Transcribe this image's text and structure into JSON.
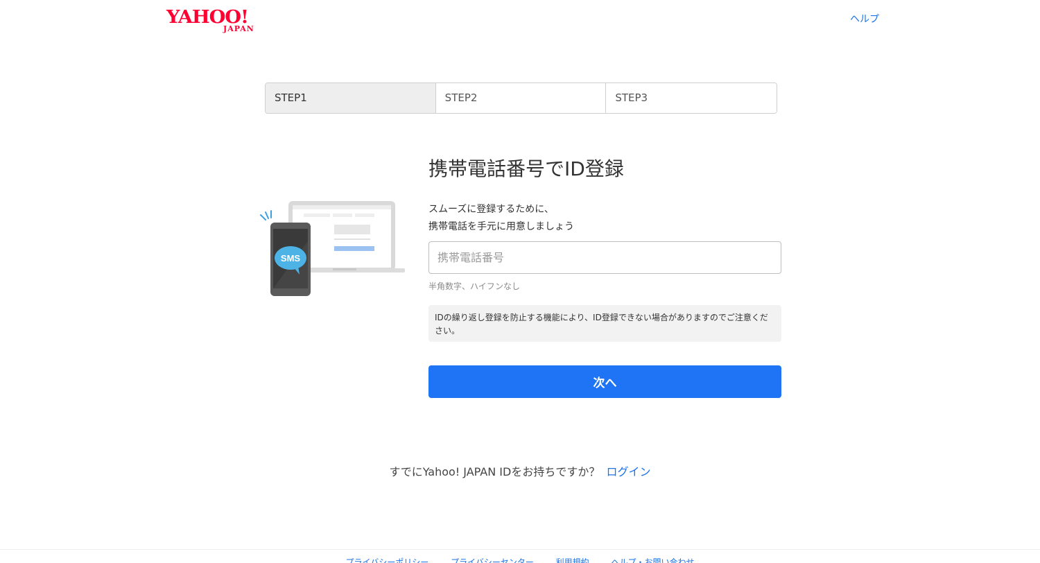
{
  "header": {
    "logo_main": "YAHOO!",
    "logo_sub": "JAPAN",
    "help_label": "ヘルプ"
  },
  "steps": [
    {
      "label": "STEP1",
      "active": true
    },
    {
      "label": "STEP2",
      "active": false
    },
    {
      "label": "STEP3",
      "active": false
    }
  ],
  "illustration": {
    "badge_text": "SMS"
  },
  "main": {
    "title": "携帯電話番号でID登録",
    "lead_line1": "スムーズに登録するために、",
    "lead_line2": "携帯電話を手元に用意しましょう",
    "phone_placeholder": "携帯電話番号",
    "phone_value": "",
    "hint": "半角数字、ハイフンなし",
    "notice": "IDの繰り返し登録を防止する機能により、ID登録できない場合がありますのでご注意ください。",
    "next_label": "次へ",
    "already_text": "すでにYahoo! JAPAN IDをお持ちですか？",
    "login_label": "ログイン"
  },
  "footer": {
    "links": [
      "プライバシーポリシー",
      "プライバシーセンター",
      "利用規約",
      "ヘルプ・お問い合わせ"
    ]
  },
  "colors": {
    "brand": "#ff0033",
    "primary_button": "#1e74f5",
    "link": "#1a73e8"
  }
}
